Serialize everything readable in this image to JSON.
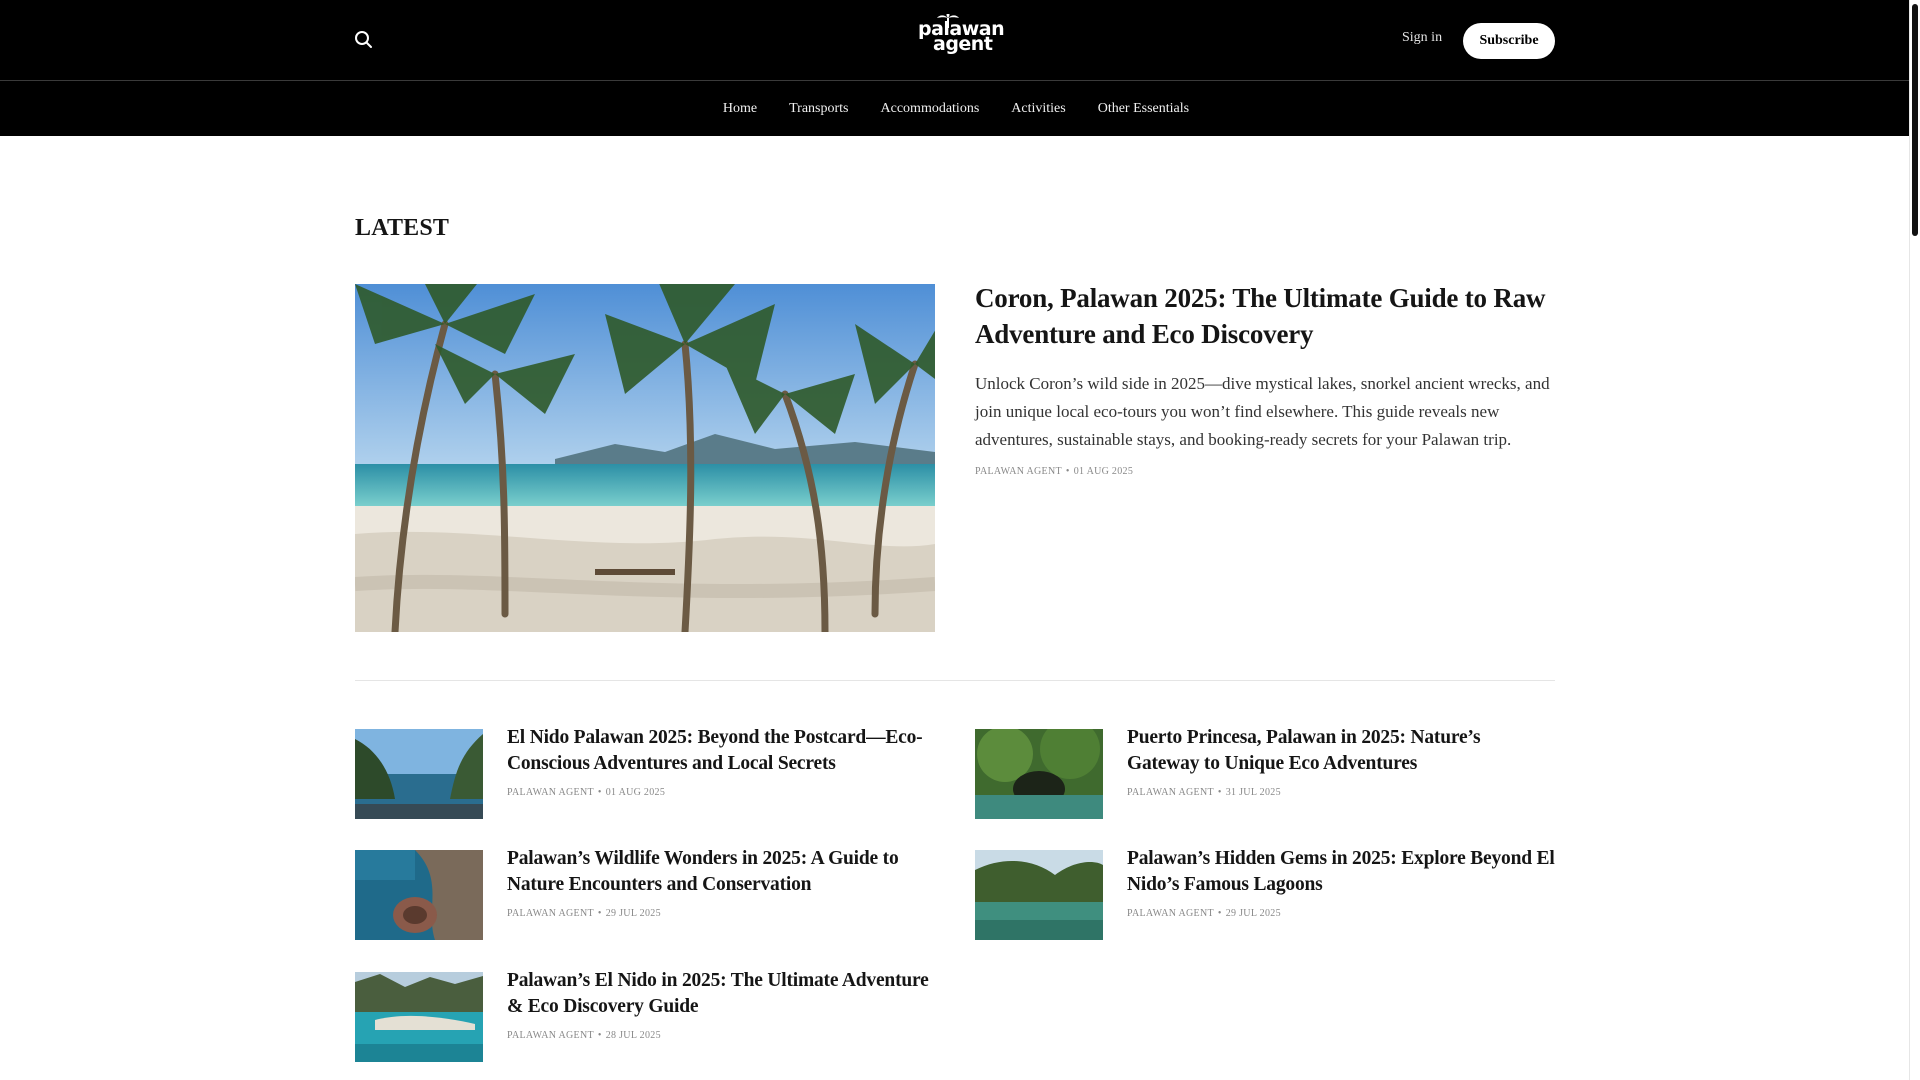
{
  "header": {
    "logo": {
      "line1": "palawan",
      "line2": "agent"
    },
    "signin_label": "Sign in",
    "subscribe_label": "Subscribe",
    "nav": [
      "Home",
      "Transports",
      "Accommodations",
      "Activities",
      "Other Essentials"
    ]
  },
  "section": {
    "title": "LATEST"
  },
  "featured": {
    "title": "Coron, Palawan 2025: The Ultimate Guide to Raw Adventure and Eco Discovery",
    "excerpt": "Unlock Coron’s wild side in 2025—dive mystical lakes, snorkel ancient wrecks, and join unique local eco-tours you won’t find elsewhere. This guide reveals new adventures, sustainable stays, and booking-ready secrets for your Palawan trip.",
    "author": "PALAWAN AGENT",
    "date": "01 AUG 2025"
  },
  "posts": [
    {
      "title": "El Nido Palawan 2025: Beyond the Postcard—Eco-Conscious Adventures and Local Secrets",
      "author": "PALAWAN AGENT",
      "date": "01 AUG 2025"
    },
    {
      "title": "Puerto Princesa, Palawan in 2025: Nature’s Gateway to Unique Eco Adventures",
      "author": "PALAWAN AGENT",
      "date": "31 JUL 2025"
    },
    {
      "title": "Palawan’s Wildlife Wonders in 2025: A Guide to Nature Encounters and Conservation",
      "author": "PALAWAN AGENT",
      "date": "29 JUL 2025"
    },
    {
      "title": "Palawan’s Hidden Gems in 2025: Explore Beyond El Nido’s Famous Lagoons",
      "author": "PALAWAN AGENT",
      "date": "29 JUL 2025"
    },
    {
      "title": "Palawan’s El Nido in 2025: The Ultimate Adventure & Eco Discovery Guide",
      "author": "PALAWAN AGENT",
      "date": "28 JUL 2025"
    }
  ],
  "colors": {
    "header_bg": "#000000",
    "text": "#151515",
    "meta": "#888888"
  },
  "icons": {
    "search": "search-icon",
    "logo": "palm-tree-icon"
  }
}
